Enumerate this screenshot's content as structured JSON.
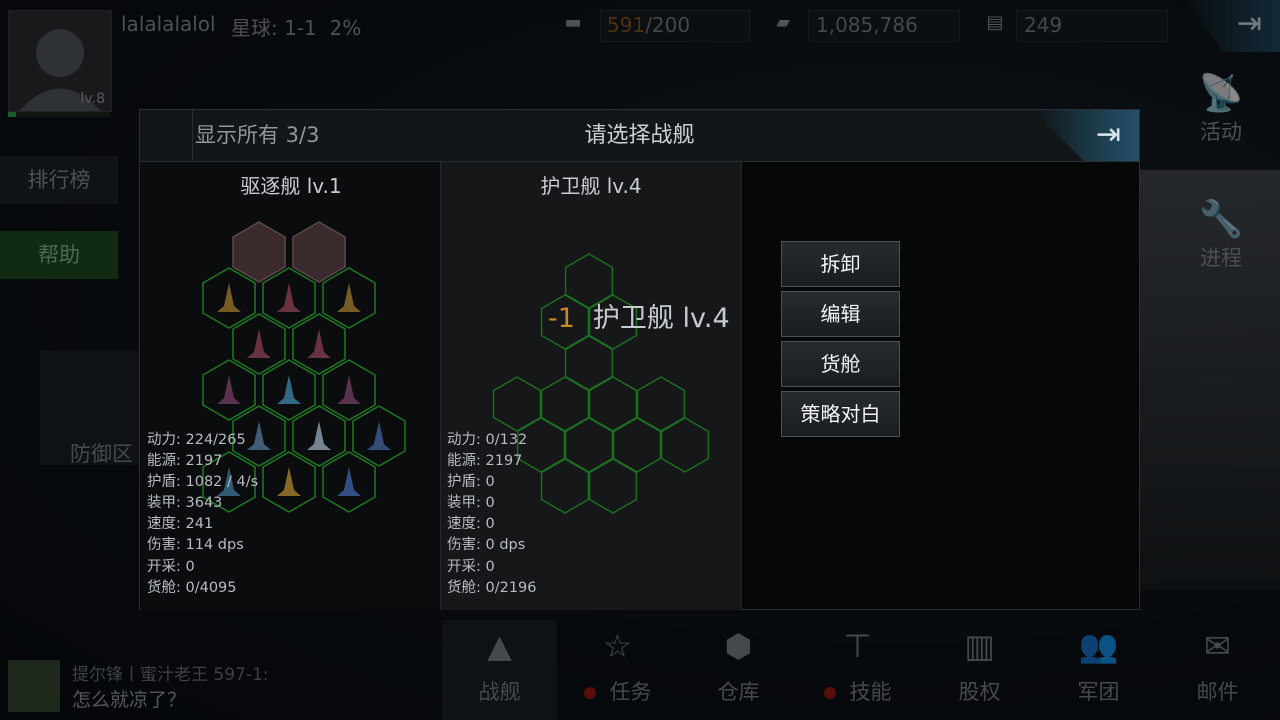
{
  "player": {
    "name": "lalalalalol",
    "planet": "星球: 1-1  2%",
    "level": "lv.8"
  },
  "resources": {
    "energy_current": "591",
    "energy_max": "/200",
    "credits": "1,085,786",
    "cargo": "249"
  },
  "left_menu": {
    "ranking": "排行榜",
    "help": "帮助",
    "defense": "防御区"
  },
  "right_menu": {
    "activity": "活动",
    "progress": "进程"
  },
  "chat": {
    "sender": "提尔锋丨蜜汁老王 597-1:",
    "message": "怎么就凉了？"
  },
  "bottom_nav": [
    {
      "label": "战舰",
      "icon": "ship-icon"
    },
    {
      "label": "任务",
      "icon": "star-doc-icon"
    },
    {
      "label": "仓库",
      "icon": "cubes-icon"
    },
    {
      "label": "技能",
      "icon": "tree-icon"
    },
    {
      "label": "股权",
      "icon": "chart-icon"
    },
    {
      "label": "军团",
      "icon": "group-icon"
    },
    {
      "label": "邮件",
      "icon": "mail-icon"
    }
  ],
  "modal": {
    "title": "请选择战舰",
    "show_all": "显示所有 3/3",
    "ships": [
      {
        "title": "驱逐舰 lv.1",
        "stats": [
          "动力: 224/265",
          "能源: 2197",
          "护盾: 1082 / 4/s",
          "装甲: 3643",
          "速度: 241",
          "伤害: 114 dps",
          "开采: 0",
          "货舱: 0/4095"
        ]
      },
      {
        "title": "护卫舰 lv.4",
        "stats": [
          "动力: 0/132",
          "能源: 2197",
          "护盾: 0",
          "装甲: 0",
          "速度: 0",
          "伤害: 0 dps",
          "开采: 0",
          "货舱: 0/2196"
        ]
      }
    ],
    "drag_label": {
      "count": "-1",
      "name": "护卫舰 lv.4"
    },
    "actions": [
      "拆卸",
      "编辑",
      "货舱",
      "策略对白"
    ]
  },
  "colors": {
    "hex_green": "#1f7a24",
    "accent_orange": "#c98b1c",
    "modal_bg": "#060808"
  }
}
